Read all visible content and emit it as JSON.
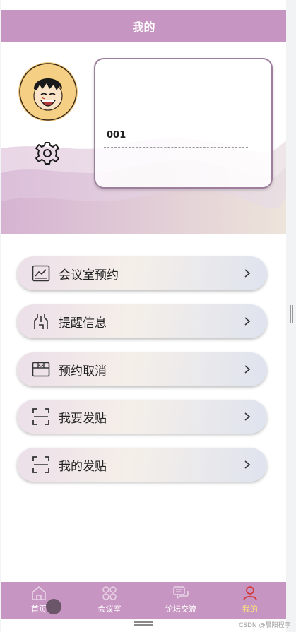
{
  "header": {
    "title": "我的"
  },
  "profile": {
    "user_id": "001"
  },
  "menu": [
    {
      "label": "会议室预约",
      "icon": "chart-line-icon"
    },
    {
      "label": "提醒信息",
      "icon": "reminder-icon"
    },
    {
      "label": "预约取消",
      "icon": "box-cancel-icon"
    },
    {
      "label": "我要发贴",
      "icon": "scan-frame-icon"
    },
    {
      "label": "我的发贴",
      "icon": "scan-frame-icon"
    }
  ],
  "tabbar": {
    "tabs": [
      {
        "label": "首页",
        "icon": "home-icon"
      },
      {
        "label": "会议室",
        "icon": "grid-icon"
      },
      {
        "label": "论坛交流",
        "icon": "chat-icon"
      },
      {
        "label": "我的",
        "icon": "user-icon",
        "active": true
      }
    ]
  },
  "watermark": "CSDN @晨阳程序",
  "colors": {
    "accent": "#c795c2",
    "active_tab": "#f7e27c"
  }
}
